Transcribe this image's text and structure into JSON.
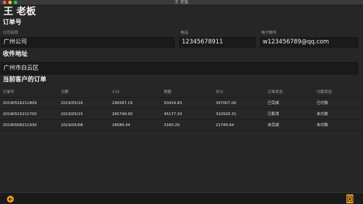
{
  "window": {
    "title": "王 老板"
  },
  "page": {
    "title": "王 老板"
  },
  "order_section": {
    "title": "订单号",
    "company": {
      "label": "公司名称",
      "value": "广州公司"
    },
    "phone": {
      "label": "电话",
      "value": "12345678911"
    },
    "email": {
      "label": "电子邮件",
      "value": "w123456789@qq.com"
    }
  },
  "address_section": {
    "title": "收件地址",
    "value": "广州市白云区"
  },
  "orders_section": {
    "title": "当前客户的订单",
    "columns": [
      "订单号",
      "日期",
      "小计",
      "税额",
      "总计",
      "订单状态",
      "付款状态"
    ],
    "rows": [
      [
        "20190516211809",
        "2019/05/16",
        "296587.19",
        "50419.83",
        "347007.00",
        "已完成",
        "已付款"
      ],
      [
        "20190515211700",
        "2019/05/15",
        "265749.00",
        "45177.33",
        "310926.31",
        "已取消",
        "未付款"
      ],
      [
        "20190508211930",
        "2019/05/08",
        "18589.44",
        "3160.20",
        "21749.64",
        "未完成",
        "未付款"
      ]
    ]
  },
  "icons": {
    "back": "back-arrow-icon",
    "export": "excel-icon"
  },
  "colors": {
    "background": "#262626",
    "field_bg": "#1a1a1a",
    "accent": "#f0a020"
  }
}
